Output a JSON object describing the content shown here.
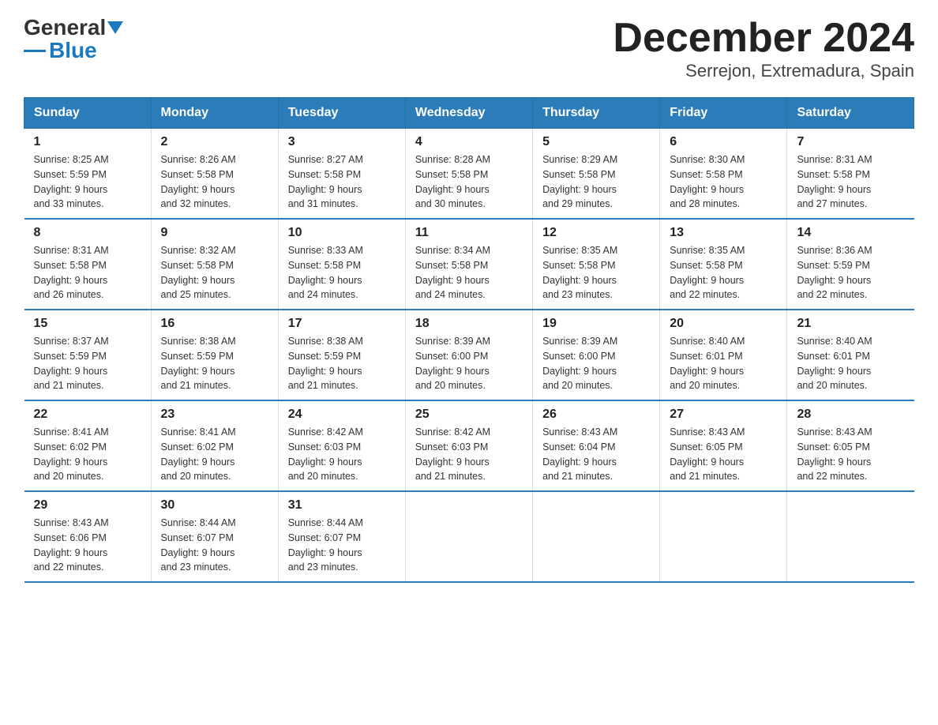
{
  "logo": {
    "text_general": "General",
    "text_blue": "Blue"
  },
  "title": "December 2024",
  "subtitle": "Serrejon, Extremadura, Spain",
  "days_header": [
    "Sunday",
    "Monday",
    "Tuesday",
    "Wednesday",
    "Thursday",
    "Friday",
    "Saturday"
  ],
  "weeks": [
    [
      {
        "day": "1",
        "sunrise": "8:25 AM",
        "sunset": "5:59 PM",
        "daylight": "9 hours and 33 minutes."
      },
      {
        "day": "2",
        "sunrise": "8:26 AM",
        "sunset": "5:58 PM",
        "daylight": "9 hours and 32 minutes."
      },
      {
        "day": "3",
        "sunrise": "8:27 AM",
        "sunset": "5:58 PM",
        "daylight": "9 hours and 31 minutes."
      },
      {
        "day": "4",
        "sunrise": "8:28 AM",
        "sunset": "5:58 PM",
        "daylight": "9 hours and 30 minutes."
      },
      {
        "day": "5",
        "sunrise": "8:29 AM",
        "sunset": "5:58 PM",
        "daylight": "9 hours and 29 minutes."
      },
      {
        "day": "6",
        "sunrise": "8:30 AM",
        "sunset": "5:58 PM",
        "daylight": "9 hours and 28 minutes."
      },
      {
        "day": "7",
        "sunrise": "8:31 AM",
        "sunset": "5:58 PM",
        "daylight": "9 hours and 27 minutes."
      }
    ],
    [
      {
        "day": "8",
        "sunrise": "8:31 AM",
        "sunset": "5:58 PM",
        "daylight": "9 hours and 26 minutes."
      },
      {
        "day": "9",
        "sunrise": "8:32 AM",
        "sunset": "5:58 PM",
        "daylight": "9 hours and 25 minutes."
      },
      {
        "day": "10",
        "sunrise": "8:33 AM",
        "sunset": "5:58 PM",
        "daylight": "9 hours and 24 minutes."
      },
      {
        "day": "11",
        "sunrise": "8:34 AM",
        "sunset": "5:58 PM",
        "daylight": "9 hours and 24 minutes."
      },
      {
        "day": "12",
        "sunrise": "8:35 AM",
        "sunset": "5:58 PM",
        "daylight": "9 hours and 23 minutes."
      },
      {
        "day": "13",
        "sunrise": "8:35 AM",
        "sunset": "5:58 PM",
        "daylight": "9 hours and 22 minutes."
      },
      {
        "day": "14",
        "sunrise": "8:36 AM",
        "sunset": "5:59 PM",
        "daylight": "9 hours and 22 minutes."
      }
    ],
    [
      {
        "day": "15",
        "sunrise": "8:37 AM",
        "sunset": "5:59 PM",
        "daylight": "9 hours and 21 minutes."
      },
      {
        "day": "16",
        "sunrise": "8:38 AM",
        "sunset": "5:59 PM",
        "daylight": "9 hours and 21 minutes."
      },
      {
        "day": "17",
        "sunrise": "8:38 AM",
        "sunset": "5:59 PM",
        "daylight": "9 hours and 21 minutes."
      },
      {
        "day": "18",
        "sunrise": "8:39 AM",
        "sunset": "6:00 PM",
        "daylight": "9 hours and 20 minutes."
      },
      {
        "day": "19",
        "sunrise": "8:39 AM",
        "sunset": "6:00 PM",
        "daylight": "9 hours and 20 minutes."
      },
      {
        "day": "20",
        "sunrise": "8:40 AM",
        "sunset": "6:01 PM",
        "daylight": "9 hours and 20 minutes."
      },
      {
        "day": "21",
        "sunrise": "8:40 AM",
        "sunset": "6:01 PM",
        "daylight": "9 hours and 20 minutes."
      }
    ],
    [
      {
        "day": "22",
        "sunrise": "8:41 AM",
        "sunset": "6:02 PM",
        "daylight": "9 hours and 20 minutes."
      },
      {
        "day": "23",
        "sunrise": "8:41 AM",
        "sunset": "6:02 PM",
        "daylight": "9 hours and 20 minutes."
      },
      {
        "day": "24",
        "sunrise": "8:42 AM",
        "sunset": "6:03 PM",
        "daylight": "9 hours and 20 minutes."
      },
      {
        "day": "25",
        "sunrise": "8:42 AM",
        "sunset": "6:03 PM",
        "daylight": "9 hours and 21 minutes."
      },
      {
        "day": "26",
        "sunrise": "8:43 AM",
        "sunset": "6:04 PM",
        "daylight": "9 hours and 21 minutes."
      },
      {
        "day": "27",
        "sunrise": "8:43 AM",
        "sunset": "6:05 PM",
        "daylight": "9 hours and 21 minutes."
      },
      {
        "day": "28",
        "sunrise": "8:43 AM",
        "sunset": "6:05 PM",
        "daylight": "9 hours and 22 minutes."
      }
    ],
    [
      {
        "day": "29",
        "sunrise": "8:43 AM",
        "sunset": "6:06 PM",
        "daylight": "9 hours and 22 minutes."
      },
      {
        "day": "30",
        "sunrise": "8:44 AM",
        "sunset": "6:07 PM",
        "daylight": "9 hours and 23 minutes."
      },
      {
        "day": "31",
        "sunrise": "8:44 AM",
        "sunset": "6:07 PM",
        "daylight": "9 hours and 23 minutes."
      },
      null,
      null,
      null,
      null
    ]
  ],
  "labels": {
    "sunrise": "Sunrise:",
    "sunset": "Sunset:",
    "daylight": "Daylight:"
  }
}
